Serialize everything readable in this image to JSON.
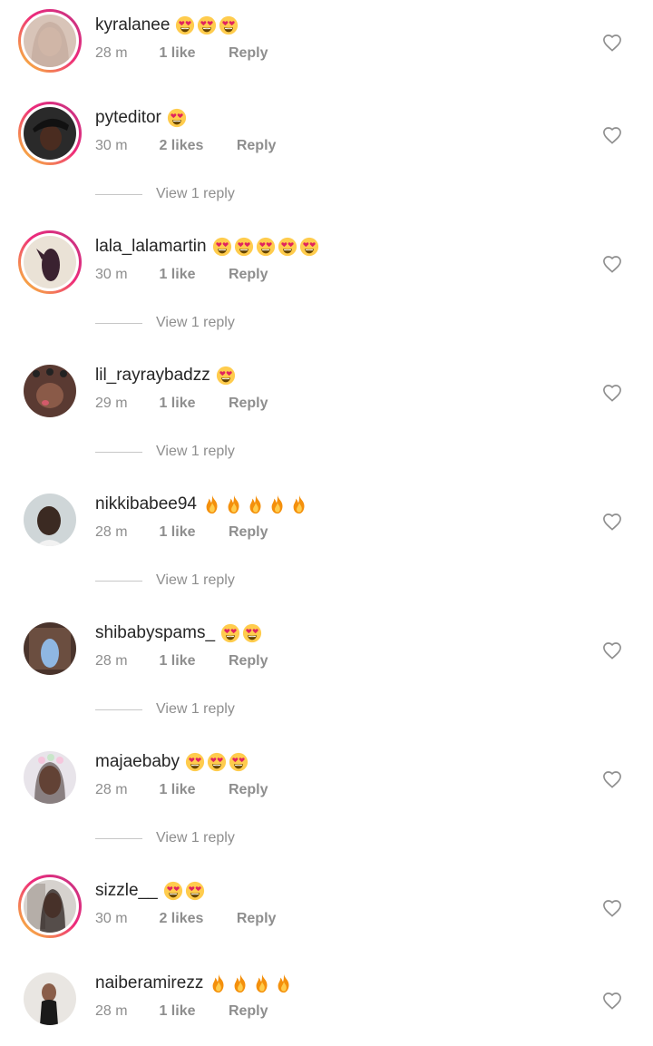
{
  "comments": [
    {
      "username": "kyralanee",
      "emoji": [
        "heart-eyes",
        "heart-eyes",
        "heart-eyes"
      ],
      "time": "28 m",
      "likes": "1 like",
      "reply": "Reply",
      "story_ring": true,
      "view_replies": ""
    },
    {
      "username": "pyteditor",
      "emoji": [
        "heart-eyes"
      ],
      "time": "30 m",
      "likes": "2 likes",
      "reply": "Reply",
      "story_ring": true,
      "view_replies": "View 1 reply"
    },
    {
      "username": "lala_lalamartin",
      "emoji": [
        "heart-eyes",
        "heart-eyes",
        "heart-eyes",
        "heart-eyes",
        "heart-eyes"
      ],
      "time": "30 m",
      "likes": "1 like",
      "reply": "Reply",
      "story_ring": true,
      "view_replies": "View 1 reply"
    },
    {
      "username": "lil_rayraybadzz",
      "emoji": [
        "heart-eyes"
      ],
      "time": "29 m",
      "likes": "1 like",
      "reply": "Reply",
      "story_ring": false,
      "view_replies": "View 1 reply"
    },
    {
      "username": "nikkibabee94",
      "emoji": [
        "fire",
        "fire",
        "fire",
        "fire",
        "fire"
      ],
      "time": "28 m",
      "likes": "1 like",
      "reply": "Reply",
      "story_ring": false,
      "view_replies": "View 1 reply"
    },
    {
      "username": "shibabyspams_",
      "emoji": [
        "heart-eyes",
        "heart-eyes"
      ],
      "time": "28 m",
      "likes": "1 like",
      "reply": "Reply",
      "story_ring": false,
      "view_replies": "View 1 reply"
    },
    {
      "username": "majaebaby",
      "emoji": [
        "heart-eyes",
        "heart-eyes",
        "heart-eyes"
      ],
      "time": "28 m",
      "likes": "1 like",
      "reply": "Reply",
      "story_ring": false,
      "view_replies": "View 1 reply"
    },
    {
      "username": "sizzle__",
      "emoji": [
        "heart-eyes",
        "heart-eyes"
      ],
      "time": "30 m",
      "likes": "2 likes",
      "reply": "Reply",
      "story_ring": true,
      "view_replies": ""
    },
    {
      "username": "naiberamirezz",
      "emoji": [
        "fire",
        "fire",
        "fire",
        "fire"
      ],
      "time": "28 m",
      "likes": "1 like",
      "reply": "Reply",
      "story_ring": false,
      "view_replies": ""
    }
  ],
  "colors": {
    "text_primary": "#262626",
    "text_secondary": "#8e8e8e",
    "story_ring_start": "#f9ce34",
    "story_ring_end": "#c13584"
  },
  "icons": {
    "like": "heart-outline-icon",
    "heart_eyes": "heart-eyes-emoji",
    "fire": "fire-emoji"
  }
}
